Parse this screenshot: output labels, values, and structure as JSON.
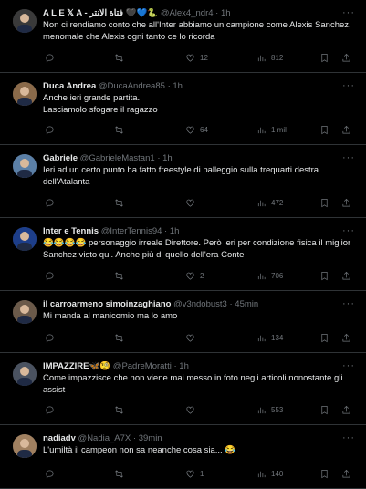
{
  "tweets": [
    {
      "name": "A L E 𝕏 A - فتاة الانتر 🖤💙🐍",
      "handle": "@Alex4_ndr4",
      "time": "1h",
      "text": "Non ci rendiamo conto che all'Inter abbiamo un campione come Alexis Sanchez, menomale che Alexis ogni tanto ce lo ricorda",
      "replies": "",
      "retweets": "",
      "likes": "12",
      "views": "812",
      "avatar_color": "#3a3a3a"
    },
    {
      "name": "Duca Andrea",
      "handle": "@DucaAndrea85",
      "time": "1h",
      "text": "Anche ieri grande partita.\nLasciamolo sfogare il ragazzo",
      "replies": "",
      "retweets": "",
      "likes": "64",
      "views": "1 mil",
      "avatar_color": "#8a6a4a"
    },
    {
      "name": "Gabriele",
      "handle": "@GabrieleMastan1",
      "time": "1h",
      "text": "Ieri ad un certo punto ha fatto freestyle di palleggio sulla trequarti destra dell'Atalanta",
      "replies": "",
      "retweets": "",
      "likes": "",
      "views": "472",
      "avatar_color": "#5b7fa6"
    },
    {
      "name": "Inter e Tennis",
      "handle": "@InterTennis94",
      "time": "1h",
      "text": "😂😂😂😂 personaggio irreale Direttore. Però ieri per condizione fisica il miglior Sanchez visto qui. Anche più di quello dell'era Conte",
      "replies": "",
      "retweets": "",
      "likes": "2",
      "views": "706",
      "avatar_color": "#1d3e8a"
    },
    {
      "name": "il carroarmeno simoinzaghiano",
      "handle": "@v3ndobust3",
      "time": "45min",
      "text": "Mi manda al manicomio ma lo amo",
      "replies": "",
      "retweets": "",
      "likes": "",
      "views": "134",
      "avatar_color": "#6b5a4a"
    },
    {
      "name": "IMPAZZIRE🦋🧐",
      "handle": "@PadreMoratti",
      "time": "1h",
      "text": "Come impazzisce che non viene mai messo in foto negli articoli nonostante gli assist",
      "replies": "",
      "retweets": "",
      "likes": "",
      "views": "553",
      "avatar_color": "#4a5260"
    },
    {
      "name": "nadiadv",
      "handle": "@Nadia_A7X",
      "time": "39min",
      "text": "L'umiltà il campeon non sa neanche cosa sia... 😂",
      "replies": "",
      "retweets": "",
      "likes": "1",
      "views": "140",
      "avatar_color": "#a08060"
    }
  ],
  "icons": {
    "reply": "reply-icon",
    "retweet": "retweet-icon",
    "like": "like-icon",
    "views": "views-icon",
    "bookmark": "bookmark-icon",
    "share": "share-icon",
    "more": "more-icon"
  },
  "colors": {
    "background": "#000000",
    "text": "#e7e9ea",
    "muted": "#71767b",
    "divider": "#2f3336"
  }
}
